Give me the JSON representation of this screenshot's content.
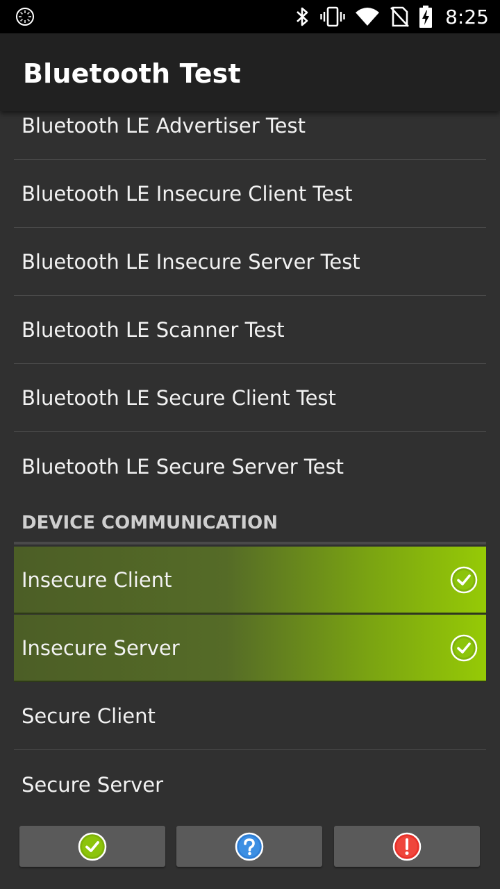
{
  "status_bar": {
    "time": "8:25"
  },
  "app_bar": {
    "title": "Bluetooth Test"
  },
  "list": {
    "partial_item": "Bluetooth LE Advertiser Test",
    "items": [
      {
        "label": "Bluetooth LE Insecure Client Test"
      },
      {
        "label": "Bluetooth LE Insecure Server Test"
      },
      {
        "label": "Bluetooth LE Scanner Test"
      },
      {
        "label": "Bluetooth LE Secure Client Test"
      },
      {
        "label": "Bluetooth LE Secure Server Test"
      }
    ],
    "section_header": "DEVICE COMMUNICATION",
    "device_items": [
      {
        "label": "Insecure Client",
        "status": "passed"
      },
      {
        "label": "Insecure Server",
        "status": "passed"
      },
      {
        "label": "Secure Client",
        "status": "not-run"
      },
      {
        "label": "Secure Server",
        "status": "not-run"
      }
    ]
  },
  "buttons": {
    "pass_icon": "check-icon",
    "info_icon": "question-icon",
    "fail_icon": "exclamation-icon"
  },
  "colors": {
    "background": "#303030",
    "app_bar": "#212121",
    "pass_green": "#96ca06",
    "info_blue": "#2f7fd6",
    "fail_red": "#e8322b"
  }
}
